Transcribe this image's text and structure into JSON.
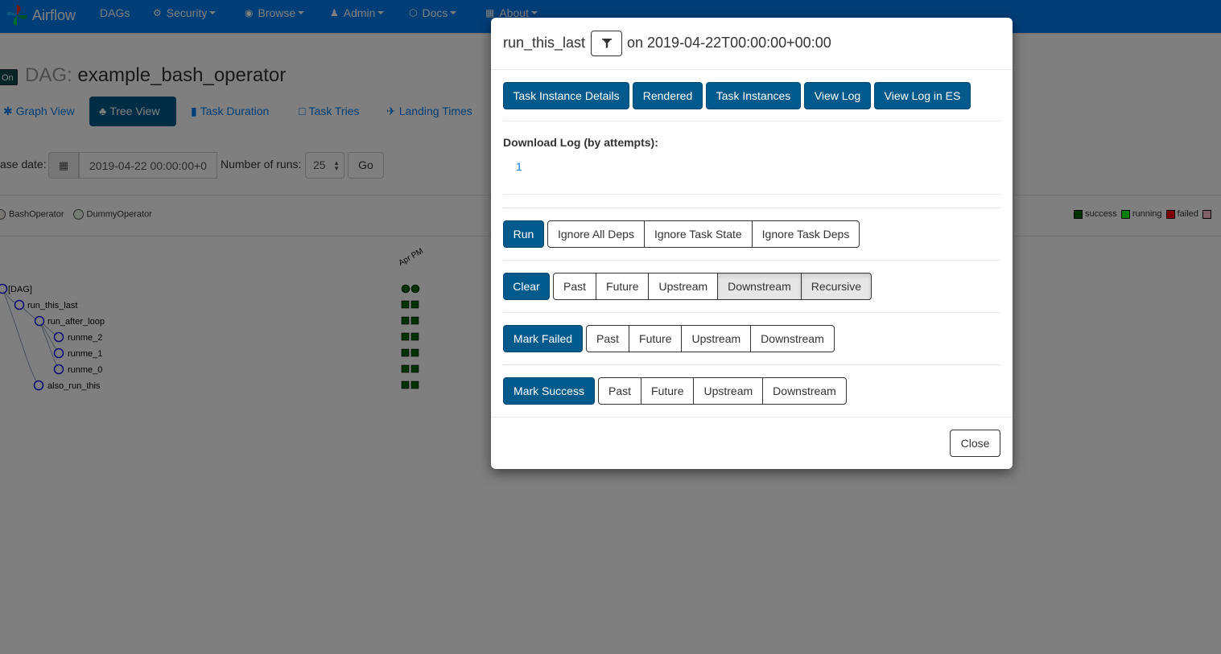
{
  "colors": {
    "navbar": "#017cee",
    "primary": "#005a8c",
    "link": "#017cee",
    "success": "#006400",
    "running": "#00ff00",
    "failed": "#ff0000",
    "upstream_failed": "#ffc0cb",
    "bash_operator": "#f0ede4",
    "dummy_operator": "#e8f7e4"
  },
  "navbar": {
    "brand": "Airflow",
    "items": [
      {
        "label": "DAGs",
        "icon": ""
      },
      {
        "label": "Security",
        "icon": "cogs-icon"
      },
      {
        "label": "Browse",
        "icon": "globe-icon"
      },
      {
        "label": "Admin",
        "icon": "user-icon"
      },
      {
        "label": "Docs",
        "icon": "cube-icon"
      },
      {
        "label": "About",
        "icon": "grid-icon"
      }
    ]
  },
  "dag": {
    "toggle": "On",
    "title_prefix": "DAG:",
    "title": "example_bash_operator",
    "tabs": [
      {
        "label": "Graph View",
        "icon": "asterisk-icon"
      },
      {
        "label": "Tree View",
        "icon": "tree-icon"
      },
      {
        "label": "Task Duration",
        "icon": "bar-chart-icon"
      },
      {
        "label": "Task Tries",
        "icon": "square-icon"
      },
      {
        "label": "Landing Times",
        "icon": "plane-icon"
      }
    ],
    "base_date_label": "ase date:",
    "base_date_value": "2019-04-22 00:00:00+00:00",
    "runs_label": "Number of runs:",
    "runs_value": "25",
    "go_label": "Go",
    "operators": [
      "BashOperator",
      "DummyOperator"
    ],
    "states": [
      "success",
      "running",
      "failed"
    ],
    "tree_nodes": [
      "[DAG]",
      "run_this_last",
      "run_after_loop",
      "runme_2",
      "runme_1",
      "runme_0",
      "also_run_this"
    ],
    "run_date_label": "Apr PM"
  },
  "modal": {
    "task_id": "run_this_last",
    "on_date": "on 2019-04-22T00:00:00+00:00",
    "top_buttons": [
      "Task Instance Details",
      "Rendered",
      "Task Instances",
      "View Log",
      "View Log in ES"
    ],
    "download_label": "Download Log (by attempts):",
    "download_attempts": [
      "1"
    ],
    "run": {
      "label": "Run",
      "options": [
        "Ignore All Deps",
        "Ignore Task State",
        "Ignore Task Deps"
      ]
    },
    "clear": {
      "label": "Clear",
      "options": [
        "Past",
        "Future",
        "Upstream",
        "Downstream",
        "Recursive"
      ]
    },
    "mark_failed": {
      "label": "Mark Failed",
      "options": [
        "Past",
        "Future",
        "Upstream",
        "Downstream"
      ]
    },
    "mark_success": {
      "label": "Mark Success",
      "options": [
        "Past",
        "Future",
        "Upstream",
        "Downstream"
      ]
    },
    "close_label": "Close"
  }
}
